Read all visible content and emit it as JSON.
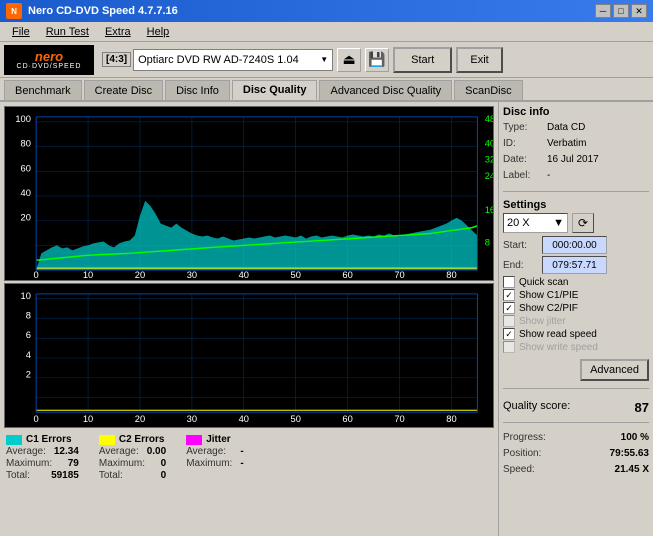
{
  "titleBar": {
    "title": "Nero CD-DVD Speed 4.7.7.16",
    "minimizeLabel": "─",
    "maximizeLabel": "□",
    "closeLabel": "✕"
  },
  "menuBar": {
    "items": [
      {
        "id": "file",
        "label": "File",
        "underline": "F"
      },
      {
        "id": "run-test",
        "label": "Run Test",
        "underline": "R"
      },
      {
        "id": "extra",
        "label": "Extra",
        "underline": "E"
      },
      {
        "id": "help",
        "label": "Help",
        "underline": "H"
      }
    ]
  },
  "toolbar": {
    "ratio": "[4:3]",
    "drive": "Optiarc DVD RW AD-7240S 1.04",
    "startLabel": "Start",
    "exitLabel": "Exit"
  },
  "tabs": [
    {
      "id": "benchmark",
      "label": "Benchmark",
      "active": false
    },
    {
      "id": "create-disc",
      "label": "Create Disc",
      "active": false
    },
    {
      "id": "disc-info",
      "label": "Disc Info",
      "active": false
    },
    {
      "id": "disc-quality",
      "label": "Disc Quality",
      "active": true
    },
    {
      "id": "advanced-disc-quality",
      "label": "Advanced Disc Quality",
      "active": false
    },
    {
      "id": "scandisc",
      "label": "ScanDisc",
      "active": false
    }
  ],
  "discInfo": {
    "sectionTitle": "Disc info",
    "fields": [
      {
        "label": "Type:",
        "value": "Data CD"
      },
      {
        "label": "ID:",
        "value": "Verbatim"
      },
      {
        "label": "Date:",
        "value": "16 Jul 2017"
      },
      {
        "label": "Label:",
        "value": "-"
      }
    ]
  },
  "settings": {
    "sectionTitle": "Settings",
    "speed": "20 X",
    "startTime": "000:00.00",
    "endTime": "079:57.71",
    "checkboxes": [
      {
        "id": "quick-scan",
        "label": "Quick scan",
        "checked": false,
        "disabled": false
      },
      {
        "id": "show-c1-pie",
        "label": "Show C1/PIE",
        "checked": true,
        "disabled": false
      },
      {
        "id": "show-c2-pif",
        "label": "Show C2/PIF",
        "checked": true,
        "disabled": false
      },
      {
        "id": "show-jitter",
        "label": "Show jitter",
        "checked": false,
        "disabled": true
      },
      {
        "id": "show-read-speed",
        "label": "Show read speed",
        "checked": true,
        "disabled": false
      },
      {
        "id": "show-write-speed",
        "label": "Show write speed",
        "checked": false,
        "disabled": true
      }
    ],
    "advancedLabel": "Advanced"
  },
  "qualityScore": {
    "label": "Quality score:",
    "value": "87"
  },
  "progress": {
    "fields": [
      {
        "label": "Progress:",
        "value": "100 %"
      },
      {
        "label": "Position:",
        "value": "79:55.63"
      },
      {
        "label": "Speed:",
        "value": "21.45 X"
      }
    ]
  },
  "legend": {
    "c1": {
      "label": "C1 Errors",
      "color": "#00ffff",
      "average": {
        "label": "Average:",
        "value": "12.34"
      },
      "maximum": {
        "label": "Maximum:",
        "value": "79"
      },
      "total": {
        "label": "Total:",
        "value": "59185"
      }
    },
    "c2": {
      "label": "C2 Errors",
      "color": "#ffff00",
      "average": {
        "label": "Average:",
        "value": "0.00"
      },
      "maximum": {
        "label": "Maximum:",
        "value": "0"
      },
      "total": {
        "label": "Total:",
        "value": "0"
      }
    },
    "jitter": {
      "label": "Jitter",
      "color": "#ff00ff",
      "average": {
        "label": "Average:",
        "value": "-"
      },
      "maximum": {
        "label": "Maximum:",
        "value": "-"
      }
    }
  },
  "chart": {
    "topYLabels": [
      "100",
      "80",
      "60",
      "40",
      "20"
    ],
    "topYRight": [
      "48",
      "40",
      "32",
      "24",
      "16",
      "8"
    ],
    "bottomYLabels": [
      "10",
      "8",
      "6",
      "4",
      "2"
    ],
    "xLabels": [
      "0",
      "10",
      "20",
      "30",
      "40",
      "50",
      "60",
      "70",
      "80"
    ]
  }
}
